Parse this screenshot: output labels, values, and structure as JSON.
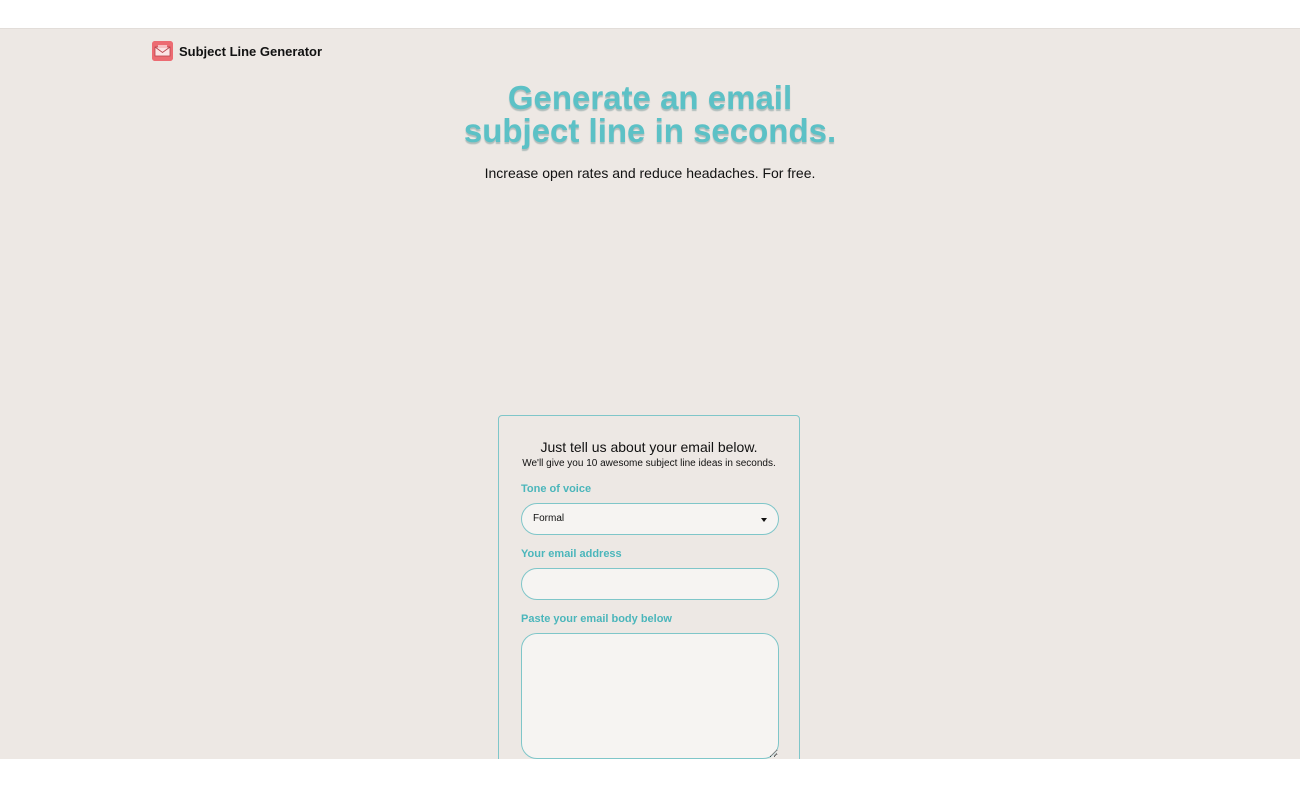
{
  "header": {
    "logo_icon": "envelope-icon",
    "app_name": "Subject Line Generator"
  },
  "hero": {
    "title_line1": "Generate an email",
    "title_line2": "subject line in seconds.",
    "subtitle": "Increase open rates and reduce headaches. For free."
  },
  "form": {
    "title": "Just tell us about your email below.",
    "subtitle": "We'll give you 10 awesome subject line ideas in seconds.",
    "tone": {
      "label": "Tone of voice",
      "selected": "Formal",
      "caret_icon": "caret-down-icon"
    },
    "email": {
      "label": "Your email address",
      "value": "",
      "placeholder": ""
    },
    "body": {
      "label": "Paste your email body below",
      "value": "",
      "placeholder": ""
    }
  },
  "colors": {
    "accent": "#5cc1c6",
    "label": "#4bb6bb",
    "background": "#ede8e4",
    "logo": "#ec6b72"
  }
}
